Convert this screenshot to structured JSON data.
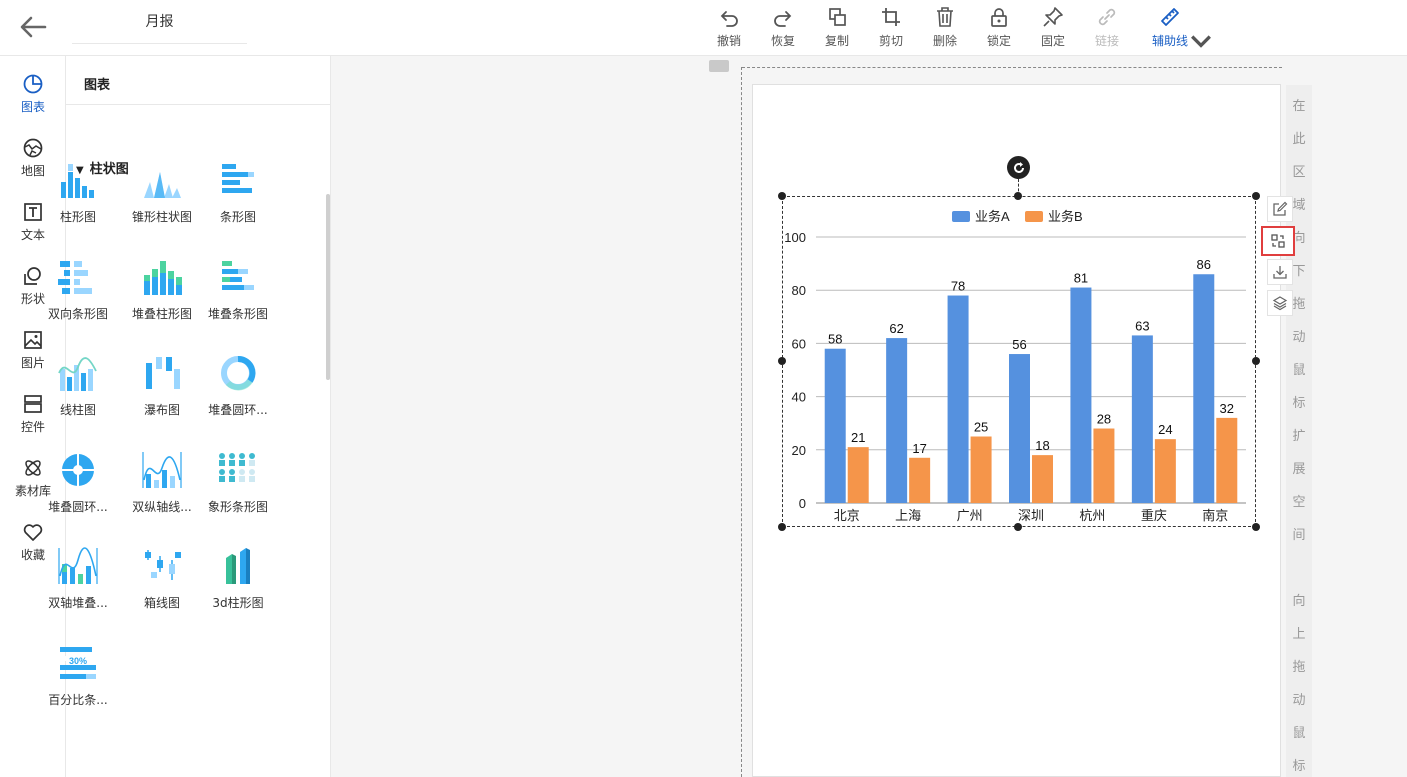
{
  "header": {
    "title": "月报"
  },
  "toolbar": [
    {
      "label": "撤销",
      "icon": "undo-icon"
    },
    {
      "label": "恢复",
      "icon": "redo-icon"
    },
    {
      "label": "复制",
      "icon": "copy-icon"
    },
    {
      "label": "剪切",
      "icon": "crop-icon"
    },
    {
      "label": "删除",
      "icon": "trash-icon"
    },
    {
      "label": "锁定",
      "icon": "lock-icon"
    },
    {
      "label": "固定",
      "icon": "pin-icon"
    },
    {
      "label": "链接",
      "icon": "link-icon",
      "disabled": true
    },
    {
      "label": "辅助线",
      "icon": "ruler-icon",
      "active": true
    }
  ],
  "nav": [
    {
      "label": "图表",
      "icon": "pie-chart-icon",
      "active": true
    },
    {
      "label": "地图",
      "icon": "map-globe-icon"
    },
    {
      "label": "文本",
      "icon": "text-icon"
    },
    {
      "label": "形状",
      "icon": "shape-icon"
    },
    {
      "label": "图片",
      "icon": "image-icon"
    },
    {
      "label": "控件",
      "icon": "widget-icon"
    },
    {
      "label": "素材库",
      "icon": "atom-icon"
    },
    {
      "label": "收藏",
      "icon": "heart-icon"
    }
  ],
  "panel": {
    "title": "图表",
    "section": "柱状图",
    "items": [
      "柱形图",
      "锥形柱状图",
      "条形图",
      "双向条形图",
      "堆叠柱形图",
      "堆叠条形图",
      "线柱图",
      "瀑布图",
      "堆叠圆环...",
      "堆叠圆环...",
      "双纵轴线...",
      "象形条形图",
      "双轴堆叠...",
      "箱线图",
      "3d柱形图",
      "百分比条..."
    ],
    "percent_badge": "30%"
  },
  "hint": {
    "down": "在此区域向下拖动鼠标扩展空间",
    "up": "向上拖动鼠标"
  },
  "colors": {
    "accent": "#1a5fc4",
    "seriesA": "#5591df",
    "seriesB": "#f5954a",
    "highlight": "#e03e3e"
  },
  "chart_data": {
    "type": "bar",
    "categories": [
      "北京",
      "上海",
      "广州",
      "深圳",
      "杭州",
      "重庆",
      "南京"
    ],
    "series": [
      {
        "name": "业务A",
        "values": [
          58,
          62,
          78,
          56,
          81,
          63,
          86
        ]
      },
      {
        "name": "业务B",
        "values": [
          21,
          17,
          25,
          18,
          28,
          24,
          32
        ]
      }
    ],
    "ylim": [
      0,
      100
    ],
    "yticks": [
      0,
      20,
      40,
      60,
      80,
      100
    ],
    "grid": true,
    "legend": "top-center"
  }
}
